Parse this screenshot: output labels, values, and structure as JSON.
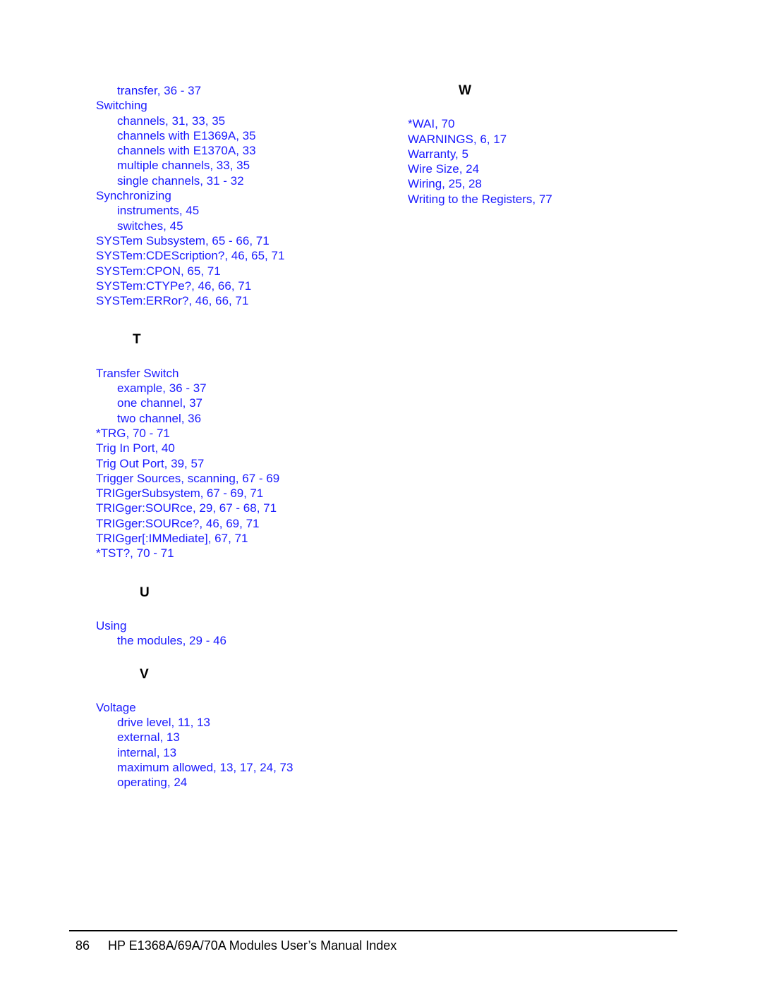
{
  "document": {
    "type": "manual-index-page",
    "text_color": "#1a1aff",
    "heading_color": "#000000"
  },
  "left_column": {
    "continued_entries": [
      {
        "level": 2,
        "text": "transfer, 36 - 37"
      },
      {
        "level": 1,
        "text": "Switching"
      },
      {
        "level": 2,
        "text": "channels, 31, 33, 35"
      },
      {
        "level": 2,
        "text": "channels with E1369A, 35"
      },
      {
        "level": 2,
        "text": "channels with E1370A, 33"
      },
      {
        "level": 2,
        "text": "multiple channels, 33, 35"
      },
      {
        "level": 2,
        "text": "single channels, 31 - 32"
      },
      {
        "level": 1,
        "text": "Synchronizing"
      },
      {
        "level": 2,
        "text": "instruments, 45"
      },
      {
        "level": 2,
        "text": "switches, 45"
      },
      {
        "level": 1,
        "text": "SYSTem Subsystem, 65 - 66, 71"
      },
      {
        "level": 1,
        "text": "SYSTem:CDEScription?, 46, 65, 71"
      },
      {
        "level": 1,
        "text": "SYSTem:CPON, 65, 71"
      },
      {
        "level": 1,
        "text": "SYSTem:CTYPe?, 46, 66, 71"
      },
      {
        "level": 1,
        "text": "SYSTem:ERRor?, 46, 66, 71"
      }
    ],
    "sections": [
      {
        "letter": "T",
        "entries": [
          {
            "level": 1,
            "text": "Transfer Switch"
          },
          {
            "level": 2,
            "text": "example, 36 - 37"
          },
          {
            "level": 2,
            "text": "one channel, 37"
          },
          {
            "level": 2,
            "text": "two channel, 36"
          },
          {
            "level": 1,
            "text": "*TRG, 70 - 71"
          },
          {
            "level": 1,
            "text": "Trig In Port, 40"
          },
          {
            "level": 1,
            "text": "Trig Out Port, 39, 57"
          },
          {
            "level": 1,
            "text": "Trigger Sources, scanning, 67 - 69"
          },
          {
            "level": 1,
            "text": "TRIGgerSubsystem, 67 - 69, 71"
          },
          {
            "level": 1,
            "text": "TRIGger:SOURce, 29, 67 - 68, 71"
          },
          {
            "level": 1,
            "text": "TRIGger:SOURce?, 46, 69, 71"
          },
          {
            "level": 1,
            "text": "TRIGger[:IMMediate], 67, 71"
          },
          {
            "level": 1,
            "text": "*TST?, 70 - 71"
          }
        ]
      },
      {
        "letter": "U",
        "entries": [
          {
            "level": 1,
            "text": "Using"
          },
          {
            "level": 2,
            "text": "the modules, 29 - 46"
          }
        ]
      },
      {
        "letter": "V",
        "entries": [
          {
            "level": 1,
            "text": "Voltage"
          },
          {
            "level": 2,
            "text": "drive level, 11, 13"
          },
          {
            "level": 2,
            "text": "external, 13"
          },
          {
            "level": 2,
            "text": "internal, 13"
          },
          {
            "level": 2,
            "text": "maximum allowed, 13, 17, 24, 73"
          },
          {
            "level": 2,
            "text": "operating, 24"
          }
        ]
      }
    ]
  },
  "right_column": {
    "sections": [
      {
        "letter": "W",
        "entries": [
          {
            "level": 1,
            "text": "*WAI, 70"
          },
          {
            "level": 1,
            "text": "WARNINGS, 6, 17"
          },
          {
            "level": 1,
            "text": "Warranty, 5"
          },
          {
            "level": 1,
            "text": "Wire Size, 24"
          },
          {
            "level": 1,
            "text": "Wiring, 25, 28"
          },
          {
            "level": 1,
            "text": "Writing to the Registers, 77"
          }
        ]
      }
    ]
  },
  "footer": {
    "page_number": "86",
    "title": "HP E1368A/69A/70A Modules User’s Manual Index"
  }
}
